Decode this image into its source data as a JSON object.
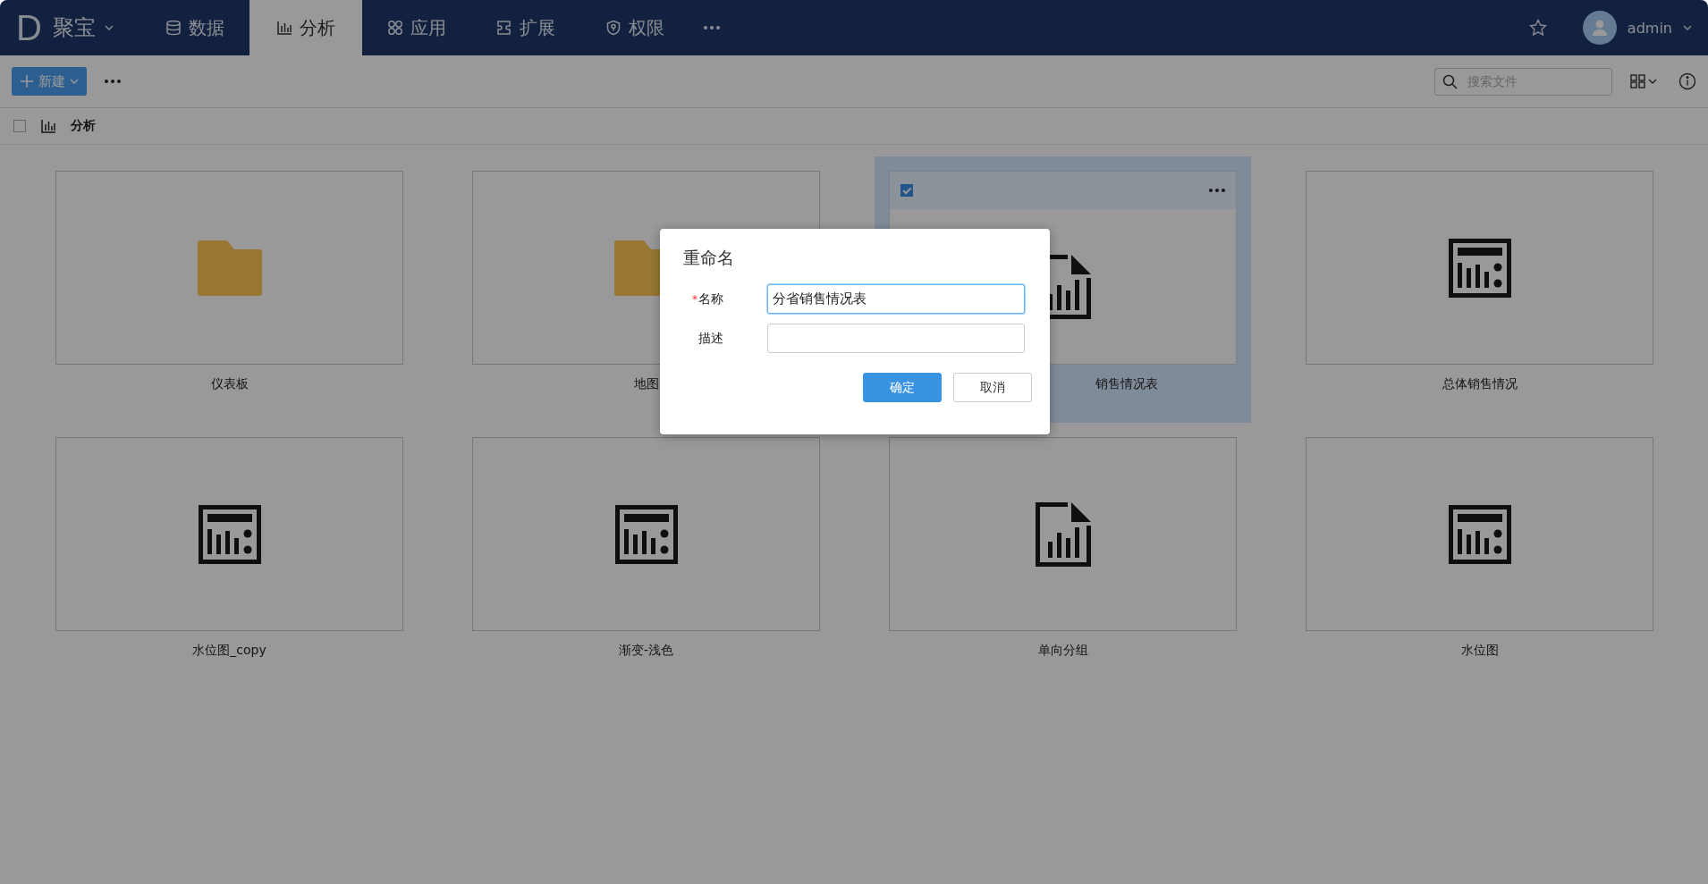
{
  "app": {
    "logo": "D",
    "name": "聚宝"
  },
  "nav": [
    {
      "label": "数据",
      "selected": false
    },
    {
      "label": "分析",
      "selected": true
    },
    {
      "label": "应用",
      "selected": false
    },
    {
      "label": "扩展",
      "selected": false
    },
    {
      "label": "权限",
      "selected": false
    }
  ],
  "user": {
    "name": "admin"
  },
  "toolbar": {
    "new_button": "新建",
    "search": {
      "placeholder": "搜索文件"
    }
  },
  "breadcrumb": {
    "checked": false,
    "label": "分析"
  },
  "items": [
    {
      "label": "仪表板",
      "kind": "folder",
      "selected": false
    },
    {
      "label": "地图",
      "kind": "folder",
      "selected": false
    },
    {
      "label": "销售情况表",
      "kind": "report",
      "selected": true,
      "covered": true
    },
    {
      "label": "总体销售情况",
      "kind": "dashboard",
      "selected": false
    },
    {
      "label": "水位图_copy",
      "kind": "dashboard",
      "selected": false
    },
    {
      "label": "渐变-浅色",
      "kind": "dashboard",
      "selected": false
    },
    {
      "label": "单向分组",
      "kind": "report",
      "selected": false
    },
    {
      "label": "水位图",
      "kind": "dashboard",
      "selected": false
    }
  ],
  "dialog": {
    "title": "重命名",
    "fields": [
      {
        "label": "名称",
        "required_mark": "*",
        "value": "分省销售情况表"
      },
      {
        "label": "描述"
      }
    ],
    "buttons": [
      {
        "label": "确定",
        "kind": "primary"
      },
      {
        "label": "取消",
        "kind": "default"
      }
    ]
  }
}
